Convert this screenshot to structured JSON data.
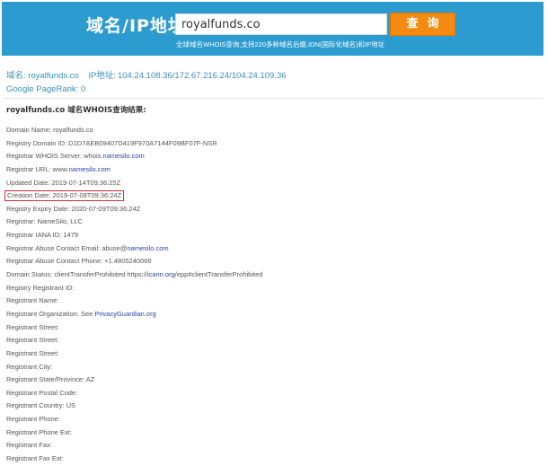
{
  "banner": {
    "label": "域名/IP地址:",
    "search_value": "royalfunds.co",
    "button_label": "查询",
    "hint": "全球域名WHOIS查询,支持220多种域名后缀,IDN(国际化域名)和IP地址"
  },
  "summary": {
    "domain_label": "域名:",
    "domain_value": "royalfunds.co",
    "ip_label": "IP地址:",
    "ip_value": "104.24.108.36/172.67.216.24/104.24.109.36",
    "pagerank_label": "Google PageRank:",
    "pagerank_value": "0"
  },
  "result_title": "royalfunds.co 域名WHOIS查询结果:",
  "records": [
    {
      "text": "Domain Name: royalfunds.co"
    },
    {
      "text": "Registry Domain ID: D1D7AEB09407D419F970A7144F09BF07F-NSR"
    },
    {
      "prefix": "Registrar WHOIS Server: whois.",
      "link": "namesilo.com",
      "suffix": ""
    },
    {
      "prefix": "Registrar URL: www.",
      "link": "namesilo.com",
      "suffix": ""
    },
    {
      "text": "Updated Date: 2019-07-14T09:36:25Z"
    },
    {
      "text": "Creation Date: 2019-07-09T09:36:24Z",
      "highlighted": true
    },
    {
      "text": "Registry Expiry Date: 2020-07-09T09:36:24Z"
    },
    {
      "text": "Registrar: NameSilo, LLC"
    },
    {
      "text": "Registrar IANA ID: 1479"
    },
    {
      "prefix": "Registrar Abuse Contact Email: abuse@",
      "link": "namesilo.com",
      "suffix": ""
    },
    {
      "text": "Registrar Abuse Contact Phone: +1.4805240066"
    },
    {
      "prefix": "Domain Status: clientTransferProhibited https://",
      "link": "icann.org",
      "suffix": "/epp#clientTransferProhibited"
    },
    {
      "text": "Registry Registrant ID:"
    },
    {
      "text": "Registrant Name:"
    },
    {
      "prefix": "Registrant Organization: See ",
      "link": "PrivacyGuardian.org",
      "suffix": ""
    },
    {
      "text": "Registrant Street:"
    },
    {
      "text": "Registrant Street:"
    },
    {
      "text": "Registrant Street:"
    },
    {
      "text": "Registrant City:"
    },
    {
      "text": "Registrant State/Province: AZ"
    },
    {
      "text": "Registrant Postal Code:"
    },
    {
      "text": "Registrant Country: US"
    },
    {
      "text": "Registrant Phone:"
    },
    {
      "text": "Registrant Phone Ext:"
    },
    {
      "text": "Registrant Fax:"
    },
    {
      "text": "Registrant Fax Ext:"
    }
  ]
}
